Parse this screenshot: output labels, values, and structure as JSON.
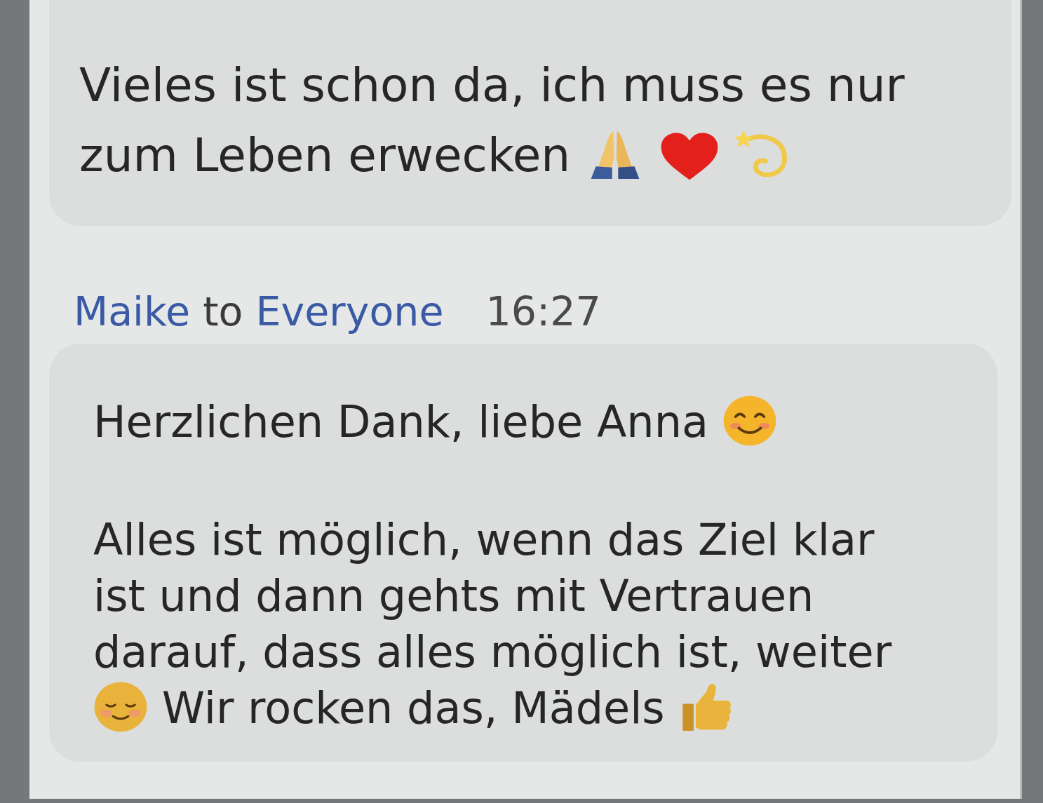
{
  "chat": {
    "messages": [
      {
        "paragraphs": [
          [
            {
              "kind": "text",
              "text": "Vieles ist schon da, ich muss es nur zum Leben erwecken"
            },
            {
              "kind": "hands"
            },
            {
              "kind": "heart"
            },
            {
              "kind": "dizzy"
            }
          ]
        ]
      },
      {
        "header": {
          "sender": "Maike",
          "connector": "to",
          "recipient": "Everyone",
          "time": "16:27"
        },
        "paragraphs": [
          [
            {
              "kind": "text",
              "text": "Herzlichen Dank, liebe Anna"
            },
            {
              "kind": "smile"
            }
          ],
          [
            {
              "kind": "text",
              "text": "Alles ist möglich, wenn das Ziel klar ist und dann gehts mit Vertrauen darauf, dass alles möglich ist, weiter"
            },
            {
              "kind": "blush"
            },
            {
              "kind": "text",
              "text": "Wir rocken das, Mädels"
            },
            {
              "kind": "thumbsup"
            }
          ]
        ]
      }
    ]
  }
}
